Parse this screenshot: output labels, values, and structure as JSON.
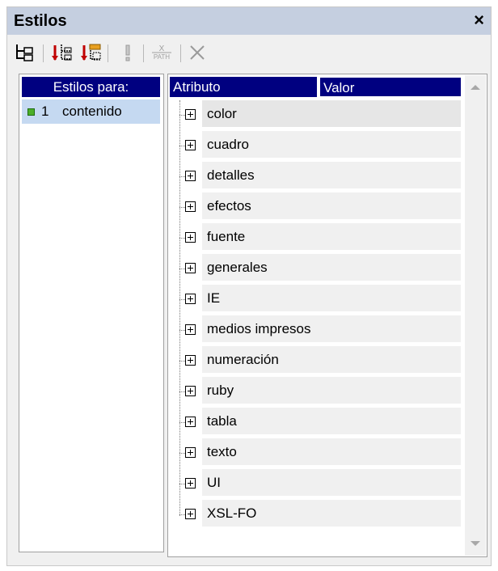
{
  "window": {
    "title": "Estilos",
    "close_label": "×"
  },
  "toolbar": {
    "icons": [
      "tree-view-icon",
      "add-style-icon",
      "add-style-from-xpath-icon",
      "important-icon",
      "xpath-icon",
      "delete-icon"
    ],
    "xpath_icon_text": "X\nPATH"
  },
  "left_panel": {
    "header": "Estilos para:",
    "items": [
      {
        "number": "1",
        "name": "contenido",
        "selected": true
      }
    ]
  },
  "right_panel": {
    "columns": {
      "attribute": "Atributo",
      "value": "Valor"
    },
    "groups": [
      "color",
      "cuadro",
      "detalles",
      "efectos",
      "fuente",
      "generales",
      "IE",
      "medios impresos",
      "numeración",
      "ruby",
      "tabla",
      "texto",
      "UI",
      "XSL-FO"
    ]
  },
  "colors": {
    "header_bg": "#000080",
    "selected_bg": "#c5d9f1",
    "titlebar_bg": "#c5cfe0"
  }
}
